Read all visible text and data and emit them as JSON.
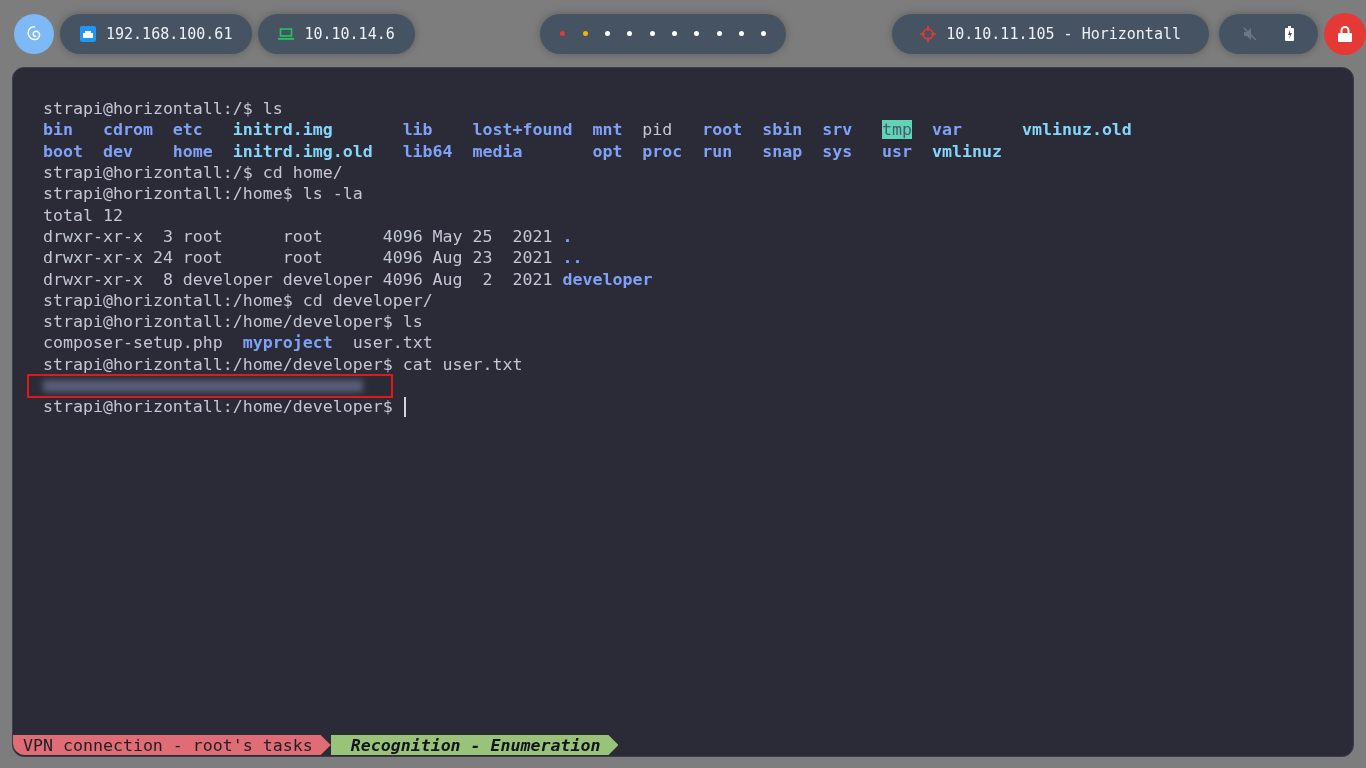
{
  "top_bar": {
    "local_ip": "192.168.100.61",
    "vpn_ip": "10.10.14.6",
    "workspaces": [
      {
        "color": "#e53935"
      },
      {
        "color": "#f5b400"
      },
      {
        "color": "#ffffff"
      },
      {
        "color": "#ffffff"
      },
      {
        "color": "#ffffff"
      },
      {
        "color": "#ffffff"
      },
      {
        "color": "#ffffff"
      },
      {
        "color": "#ffffff"
      },
      {
        "color": "#ffffff"
      },
      {
        "color": "#ffffff"
      }
    ],
    "target": "10.10.11.105 - Horizontall"
  },
  "terminal": {
    "lines": [
      [
        {
          "text": "strapi@horizontall:/$ ls",
          "kind": "plain"
        }
      ],
      [
        {
          "kind": "listing",
          "entries": [
            {
              "text": "bin",
              "kind": "dir"
            },
            {
              "text": "cdrom",
              "kind": "dir"
            },
            {
              "text": "etc",
              "kind": "dir"
            },
            {
              "text": "initrd.img",
              "kind": "link"
            },
            {
              "text": "lib",
              "kind": "dir"
            },
            {
              "text": "lost+found",
              "kind": "dir"
            },
            {
              "text": "mnt",
              "kind": "dir"
            },
            {
              "text": "pid",
              "kind": "plain"
            },
            {
              "text": "root",
              "kind": "dir"
            },
            {
              "text": "sbin",
              "kind": "dir"
            },
            {
              "text": "srv",
              "kind": "dir"
            },
            {
              "text": "tmp",
              "kind": "sticky"
            },
            {
              "text": "var",
              "kind": "dir"
            },
            {
              "text": "vmlinuz.old",
              "kind": "link"
            }
          ]
        }
      ],
      [
        {
          "kind": "listing",
          "entries": [
            {
              "text": "boot",
              "kind": "dir"
            },
            {
              "text": "dev",
              "kind": "dir"
            },
            {
              "text": "home",
              "kind": "dir"
            },
            {
              "text": "initrd.img.old",
              "kind": "link"
            },
            {
              "text": "lib64",
              "kind": "dir"
            },
            {
              "text": "media",
              "kind": "dir"
            },
            {
              "text": "opt",
              "kind": "dir"
            },
            {
              "text": "proc",
              "kind": "dir"
            },
            {
              "text": "run",
              "kind": "dir"
            },
            {
              "text": "snap",
              "kind": "dir"
            },
            {
              "text": "sys",
              "kind": "dir"
            },
            {
              "text": "usr",
              "kind": "dir"
            },
            {
              "text": "vmlinuz",
              "kind": "link"
            }
          ]
        }
      ],
      [
        {
          "text": "strapi@horizontall:/$ cd home/",
          "kind": "plain"
        }
      ],
      [
        {
          "text": "strapi@horizontall:/home$ ls -la",
          "kind": "plain"
        }
      ],
      [
        {
          "text": "total 12",
          "kind": "plain"
        }
      ],
      [
        {
          "text": "drwxr-xr-x  3 root      root      4096 May 25  2021 ",
          "kind": "plain"
        },
        {
          "text": ".",
          "kind": "dir"
        }
      ],
      [
        {
          "text": "drwxr-xr-x 24 root      root      4096 Aug 23  2021 ",
          "kind": "plain"
        },
        {
          "text": "..",
          "kind": "dir"
        }
      ],
      [
        {
          "text": "drwxr-xr-x  8 developer developer 4096 Aug  2  2021 ",
          "kind": "plain"
        },
        {
          "text": "developer",
          "kind": "dir"
        }
      ],
      [
        {
          "text": "strapi@horizontall:/home$ cd developer/",
          "kind": "plain"
        }
      ],
      [
        {
          "text": "strapi@horizontall:/home/developer$ ls",
          "kind": "plain"
        }
      ],
      [
        {
          "text": "composer-setup.php  ",
          "kind": "plain"
        },
        {
          "text": "myproject",
          "kind": "dir"
        },
        {
          "text": "  user.txt",
          "kind": "plain"
        }
      ],
      [
        {
          "text": "strapi@horizontall:/home/developer$ cat user.txt",
          "kind": "plain"
        }
      ],
      [
        {
          "kind": "redacted"
        }
      ],
      [
        {
          "text": "strapi@horizontall:/home/developer$ ",
          "kind": "plain"
        },
        {
          "kind": "cursor"
        }
      ]
    ]
  },
  "status_bar": [
    {
      "text": "VPN connection - root's tasks",
      "active": false
    },
    {
      "text": "Recognition - Enumeration",
      "active": true
    }
  ]
}
